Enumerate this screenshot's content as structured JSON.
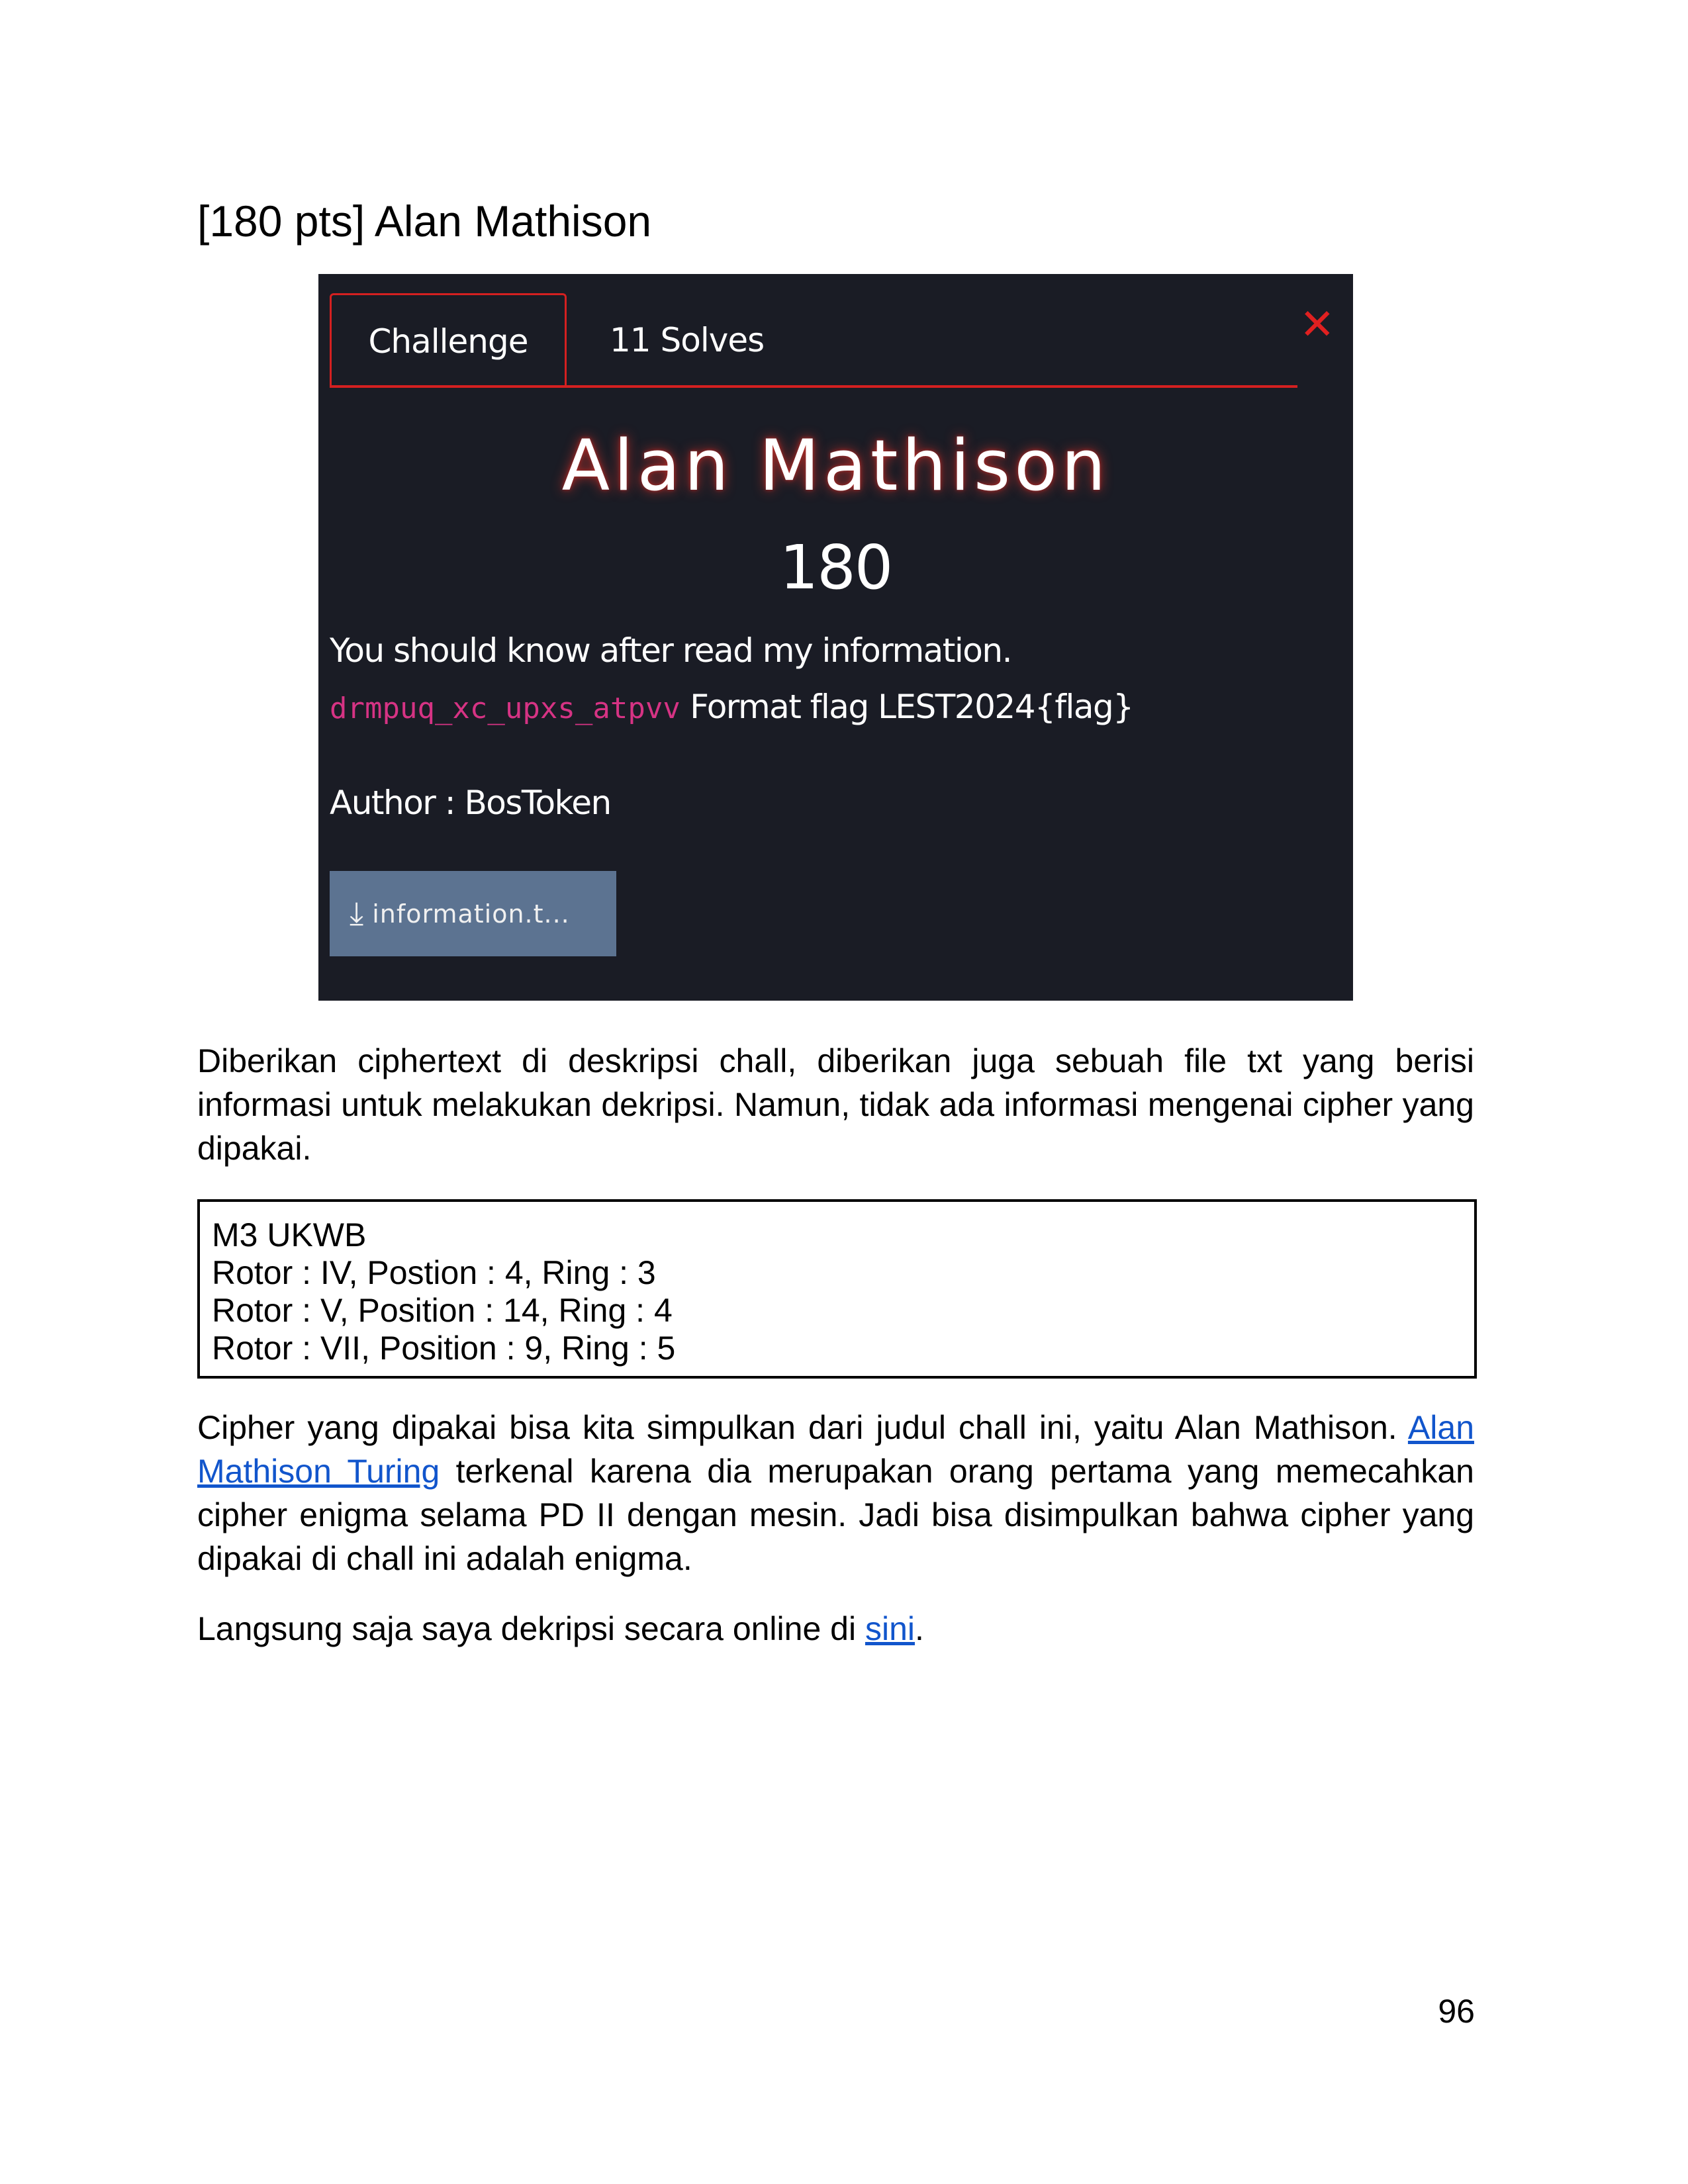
{
  "heading": "[180 pts] Alan Mathison",
  "challenge": {
    "tabs": [
      "Challenge",
      "11 Solves"
    ],
    "close_icon": "close-icon",
    "name": "Alan Mathison",
    "points": "180",
    "description": "You should know after read my information.",
    "ciphertext": "drmpuq_xc_upxs_atpvv",
    "format": "Format flag LEST2024{flag}",
    "author": "Author : BosToken",
    "file_button": "information.t...",
    "colors": {
      "background": "#1a1c25",
      "accent": "#d42020",
      "cipher": "#d63384",
      "button": "#5c7391"
    }
  },
  "p1": "Diberikan ciphertext di deskripsi chall, diberikan juga sebuah file txt yang berisi informasi untuk melakukan dekripsi. Namun, tidak ada informasi mengenai cipher yang dipakai.",
  "box_lines": [
    "M3 UKWB",
    "Rotor : IV, Postion : 4, Ring : 3",
    "Rotor : V, Position : 14, Ring : 4",
    "Rotor : VII, Position : 9, Ring : 5"
  ],
  "p2": {
    "before": "Cipher yang dipakai bisa kita simpulkan dari judul chall ini, yaitu Alan Mathison. ",
    "link": "Alan Mathison Turing",
    "after": " terkenal karena dia merupakan orang pertama yang memecahkan cipher enigma selama PD II dengan mesin. Jadi bisa disimpulkan bahwa cipher yang dipakai di chall ini adalah enigma."
  },
  "p3": {
    "before": "Langsung saja saya dekripsi secara online di ",
    "link": "sini",
    "after": "."
  },
  "page_number": "96"
}
